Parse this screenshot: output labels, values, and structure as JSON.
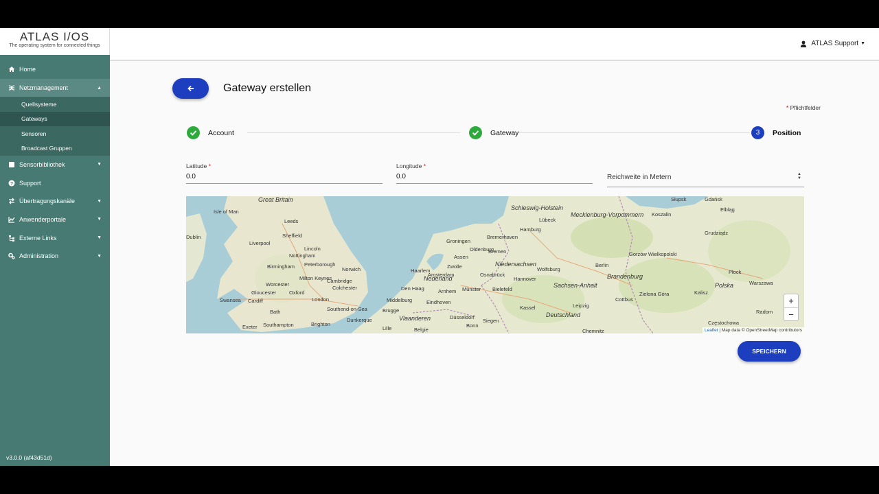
{
  "colors": {
    "sidebar": "#477a72",
    "primary": "#1d3fbf",
    "success": "#2eaa3c"
  },
  "logo": {
    "title": "ATLAS I/OS",
    "subtitle": "The operating system for connected things"
  },
  "header": {
    "user_name": "ATLAS Support"
  },
  "sidebar": {
    "items": [
      {
        "label": "Home",
        "icon": "home-icon"
      },
      {
        "label": "Netzmanagement",
        "icon": "network-icon"
      },
      {
        "label": "Sensorbibliothek",
        "icon": "library-icon"
      },
      {
        "label": "Support",
        "icon": "help-icon"
      },
      {
        "label": "Übertragungskanäle",
        "icon": "transfer-icon"
      },
      {
        "label": "Anwenderportale",
        "icon": "chart-icon"
      },
      {
        "label": "Externe Links",
        "icon": "sitemap-icon"
      },
      {
        "label": "Administration",
        "icon": "gears-icon"
      }
    ],
    "subitems": [
      "Quellsysteme",
      "Gateways",
      "Sensoren",
      "Broadcast Gruppen"
    ],
    "version": "v3.0.0 (af43d51d)"
  },
  "page": {
    "title": "Gateway erstellen",
    "required_star": "*",
    "required_note": "Pflichtfelder"
  },
  "steps": [
    {
      "label": "Account",
      "status": "done"
    },
    {
      "label": "Gateway",
      "status": "done"
    },
    {
      "number": "3",
      "label": "Position",
      "status": "current"
    }
  ],
  "form": {
    "latitude": {
      "label": "Latitude",
      "value": "0.0"
    },
    "longitude": {
      "label": "Longitude",
      "value": "0.0"
    },
    "range": {
      "placeholder": "Reichweite in Metern"
    }
  },
  "map": {
    "labels": [
      "Great Britain",
      "Isle of Man",
      "Leeds",
      "Sheffield",
      "Dublin",
      "Liverpool",
      "Lincoln",
      "Nottingham",
      "Birmingham",
      "Peterborough",
      "Norwich",
      "Milton Keynes",
      "Cambridge",
      "Colchester",
      "Worcester",
      "Oxford",
      "Gloucester",
      "London",
      "Swansea",
      "Cardiff",
      "Bath",
      "Southend-on-Sea",
      "Dunkerque",
      "Exeter",
      "Southampton",
      "Brighton",
      "Lille",
      "Belgie",
      "Groningen",
      "Assen",
      "Zwolle",
      "Haarlem",
      "Amsterdam",
      "Nederland",
      "Den Haag",
      "Arnhem",
      "Eindhoven",
      "Middelburg",
      "Brugge",
      "Vlaanderen",
      "Düsseldorf",
      "Bonn",
      "Siegen",
      "Oldenburg",
      "Bremen",
      "Bremerhaven",
      "Niedersachsen",
      "Osnabrück",
      "Münster",
      "Bielefeld",
      "Hannover",
      "Wolfsburg",
      "Hamburg",
      "Lübeck",
      "Schleswig-Holstein",
      "Kassel",
      "Deutschland",
      "Leipzig",
      "Chemnitz",
      "Berlin",
      "Sachsen-Anhalt",
      "Brandenburg",
      "Mecklenburg-Vorpommern",
      "Koszalin",
      "Słupsk",
      "Gdańsk",
      "Elbląg",
      "Grudziądz",
      "Gorzów Wielkopolski",
      "Zielona Góra",
      "Cottbus",
      "Polska",
      "Warszawa",
      "Płock",
      "Kalisz",
      "Radom",
      "Częstochowa"
    ],
    "zoom_in": "+",
    "zoom_out": "−",
    "attribution_leaflet": "Leaflet",
    "attribution_text": "| Map data © OpenStreetMap contributors"
  },
  "save_label": "SPEICHERN"
}
